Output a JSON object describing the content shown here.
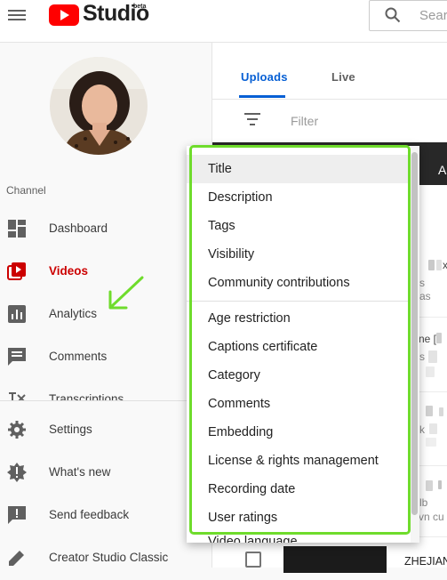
{
  "header": {
    "logo_text": "Studio",
    "logo_badge": "beta",
    "search_placeholder": "Search"
  },
  "sidebar": {
    "section_label": "Channel",
    "items": [
      {
        "label": "Dashboard",
        "icon": "dashboard-icon"
      },
      {
        "label": "Videos",
        "icon": "videos-icon",
        "active": true
      },
      {
        "label": "Analytics",
        "icon": "analytics-icon"
      },
      {
        "label": "Comments",
        "icon": "comments-icon"
      },
      {
        "label": "Transcriptions",
        "icon": "transcriptions-icon"
      }
    ],
    "bottom_items": [
      {
        "label": "Settings",
        "icon": "gear-icon"
      },
      {
        "label": "What's new",
        "icon": "whats-new-icon"
      },
      {
        "label": "Send feedback",
        "icon": "feedback-icon"
      },
      {
        "label": "Creator Studio Classic",
        "icon": "classic-icon"
      }
    ]
  },
  "main": {
    "tabs": [
      {
        "label": "Uploads",
        "active": true
      },
      {
        "label": "Live",
        "active": false
      }
    ],
    "filter_placeholder": "Filter",
    "table_header_partial": "A",
    "row_title": "ZHEJIANG",
    "cell_fragments": [
      "x",
      "s",
      "as",
      "ne [",
      "s",
      "k",
      "lb",
      "vn cu"
    ]
  },
  "dropdown": {
    "items_group1": [
      "Title",
      "Description",
      "Tags",
      "Visibility",
      "Community contributions"
    ],
    "items_group2": [
      "Age restriction",
      "Captions certificate",
      "Category",
      "Comments",
      "Embedding",
      "License & rights management",
      "Recording date",
      "User ratings"
    ],
    "partial_item": "Video language",
    "hovered_item": "Title"
  },
  "colors": {
    "accent_blue": "#065fd4",
    "brand_red": "#ff0000",
    "active_red": "#cc0000",
    "annotation_green": "#6fdc2c"
  }
}
